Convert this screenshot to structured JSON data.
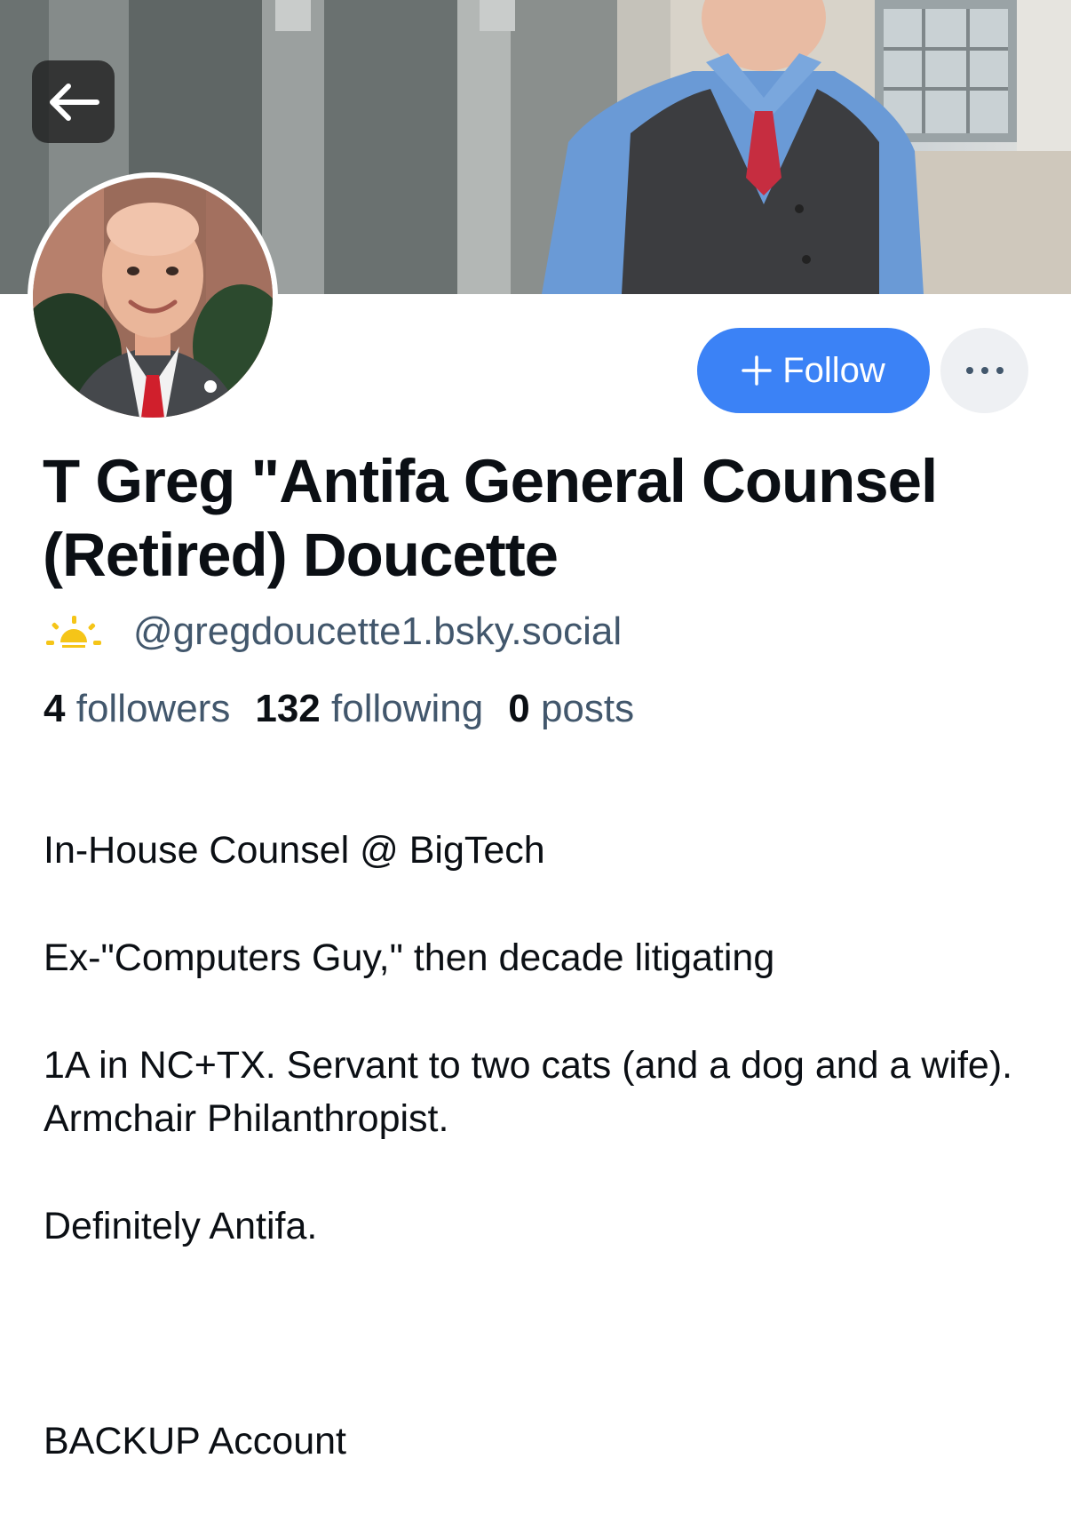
{
  "profile": {
    "display_name": "T Greg \"Antifa General Counsel (Retired) Doucette",
    "handle": "@gregdoucette1.bsky.social",
    "handle_icon": "sunrise-icon",
    "follow_label": "Follow",
    "more_icon": "ellipsis-icon",
    "back_icon": "arrow-left-icon",
    "stats": {
      "followers_count": "4",
      "followers_label": "followers",
      "following_count": "132",
      "following_label": "following",
      "posts_count": "0",
      "posts_label": "posts"
    },
    "bio_lines": [
      "In-House Counsel @ BigTech",
      "Ex-\"Computers Guy,\" then decade litigating",
      "1A in NC+TX. Servant to two cats (and a dog and a wife). Armchair Philanthropist.",
      "Definitely Antifa.",
      "",
      "BACKUP Account"
    ]
  },
  "colors": {
    "accent": "#3b82f6",
    "handle": "#42576c",
    "text": "#0b0f14",
    "more_bg": "#eef0f3",
    "sun": "#f5c518"
  }
}
